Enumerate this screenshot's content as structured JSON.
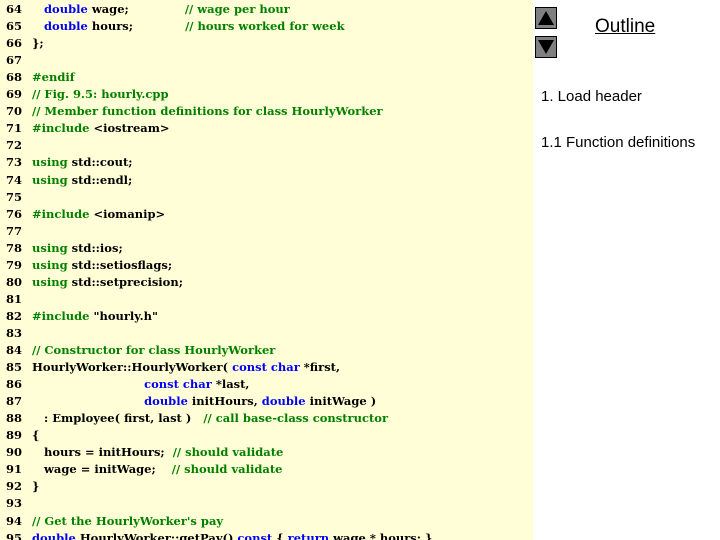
{
  "code_lines": [
    {
      "n": "64",
      "parts": [
        {
          "t": "   double wage;              ",
          "c": "kw-mix"
        },
        {
          "t": "// wage per hour",
          "c": "cm"
        }
      ]
    },
    {
      "n": "65",
      "parts": [
        {
          "t": "   double hours;             ",
          "c": "kw-mix"
        },
        {
          "t": "// hours worked for week",
          "c": "cm"
        }
      ]
    },
    {
      "n": "66",
      "parts": [
        {
          "t": "};",
          "c": ""
        }
      ]
    },
    {
      "n": "67",
      "parts": []
    },
    {
      "n": "68",
      "parts": [
        {
          "t": "#endif",
          "c": "cm"
        }
      ]
    },
    {
      "n": "69",
      "parts": [
        {
          "t": "// Fig. 9.5: hourly.cpp",
          "c": "cm"
        }
      ]
    },
    {
      "n": "70",
      "parts": [
        {
          "t": "// Member function definitions for class HourlyWorker",
          "c": "cm"
        }
      ]
    },
    {
      "n": "71",
      "parts": [
        {
          "t": "#include",
          "c": "cm"
        },
        {
          "t": " <iostream>",
          "c": ""
        }
      ]
    },
    {
      "n": "72",
      "parts": []
    },
    {
      "n": "73",
      "parts": [
        {
          "t": "using",
          "c": "cm"
        },
        {
          "t": " std::cout;",
          "c": ""
        }
      ]
    },
    {
      "n": "74",
      "parts": [
        {
          "t": "using",
          "c": "cm"
        },
        {
          "t": " std::endl;",
          "c": ""
        }
      ]
    },
    {
      "n": "75",
      "parts": []
    },
    {
      "n": "76",
      "parts": [
        {
          "t": "#include",
          "c": "cm"
        },
        {
          "t": " <iomanip>",
          "c": ""
        }
      ]
    },
    {
      "n": "77",
      "parts": []
    },
    {
      "n": "78",
      "parts": [
        {
          "t": "using",
          "c": "cm"
        },
        {
          "t": " std::ios;",
          "c": ""
        }
      ]
    },
    {
      "n": "79",
      "parts": [
        {
          "t": "using",
          "c": "cm"
        },
        {
          "t": " std::setiosflags;",
          "c": ""
        }
      ]
    },
    {
      "n": "80",
      "parts": [
        {
          "t": "using",
          "c": "cm"
        },
        {
          "t": " std::setprecision;",
          "c": ""
        }
      ]
    },
    {
      "n": "81",
      "parts": []
    },
    {
      "n": "82",
      "parts": [
        {
          "t": "#include",
          "c": "cm"
        },
        {
          "t": " \"hourly.h\"",
          "c": ""
        }
      ]
    },
    {
      "n": "83",
      "parts": []
    },
    {
      "n": "84",
      "parts": [
        {
          "t": "// Constructor for class HourlyWorker",
          "c": "cm"
        }
      ]
    },
    {
      "n": "85",
      "parts": [
        {
          "t": "HourlyWorker::HourlyWorker( ",
          "c": ""
        },
        {
          "t": "const char",
          "c": "kw"
        },
        {
          "t": " *first,",
          "c": ""
        }
      ]
    },
    {
      "n": "86",
      "parts": [
        {
          "t": "                            ",
          "c": ""
        },
        {
          "t": "const char",
          "c": "kw"
        },
        {
          "t": " *last,",
          "c": ""
        }
      ]
    },
    {
      "n": "87",
      "parts": [
        {
          "t": "                            ",
          "c": ""
        },
        {
          "t": "double",
          "c": "kw"
        },
        {
          "t": " initHours, ",
          "c": ""
        },
        {
          "t": "double",
          "c": "kw"
        },
        {
          "t": " initWage )",
          "c": ""
        }
      ]
    },
    {
      "n": "88",
      "parts": [
        {
          "t": "   : Employee( first, last )   ",
          "c": ""
        },
        {
          "t": "// call base-class constructor",
          "c": "cm"
        }
      ]
    },
    {
      "n": "89",
      "parts": [
        {
          "t": "{",
          "c": ""
        }
      ]
    },
    {
      "n": "90",
      "parts": [
        {
          "t": "   hours = initHours;  ",
          "c": ""
        },
        {
          "t": "// should validate",
          "c": "cm"
        }
      ]
    },
    {
      "n": "91",
      "parts": [
        {
          "t": "   wage = initWage;    ",
          "c": ""
        },
        {
          "t": "// should validate",
          "c": "cm"
        }
      ]
    },
    {
      "n": "92",
      "parts": [
        {
          "t": "}",
          "c": ""
        }
      ]
    },
    {
      "n": "93",
      "parts": []
    },
    {
      "n": "94",
      "parts": [
        {
          "t": "// Get the HourlyWorker's pay",
          "c": "cm"
        }
      ]
    },
    {
      "n": "95",
      "parts": [
        {
          "t": "double",
          "c": "kw"
        },
        {
          "t": " HourlyWorker::getPay() ",
          "c": ""
        },
        {
          "t": "const",
          "c": "kw"
        },
        {
          "t": " { ",
          "c": ""
        },
        {
          "t": "return",
          "c": "kw"
        },
        {
          "t": " wage * hours; }",
          "c": ""
        }
      ]
    }
  ],
  "sidebar": {
    "title": "Outline",
    "items": [
      "1. Load header",
      "1.1 Function definitions"
    ]
  },
  "nav": {
    "up_icon": "triangle-up-icon",
    "down_icon": "triangle-down-icon"
  },
  "colors": {
    "code_background": "#fffed7",
    "comment": "#008000",
    "keyword": "#0000ff",
    "button": "#808080"
  }
}
